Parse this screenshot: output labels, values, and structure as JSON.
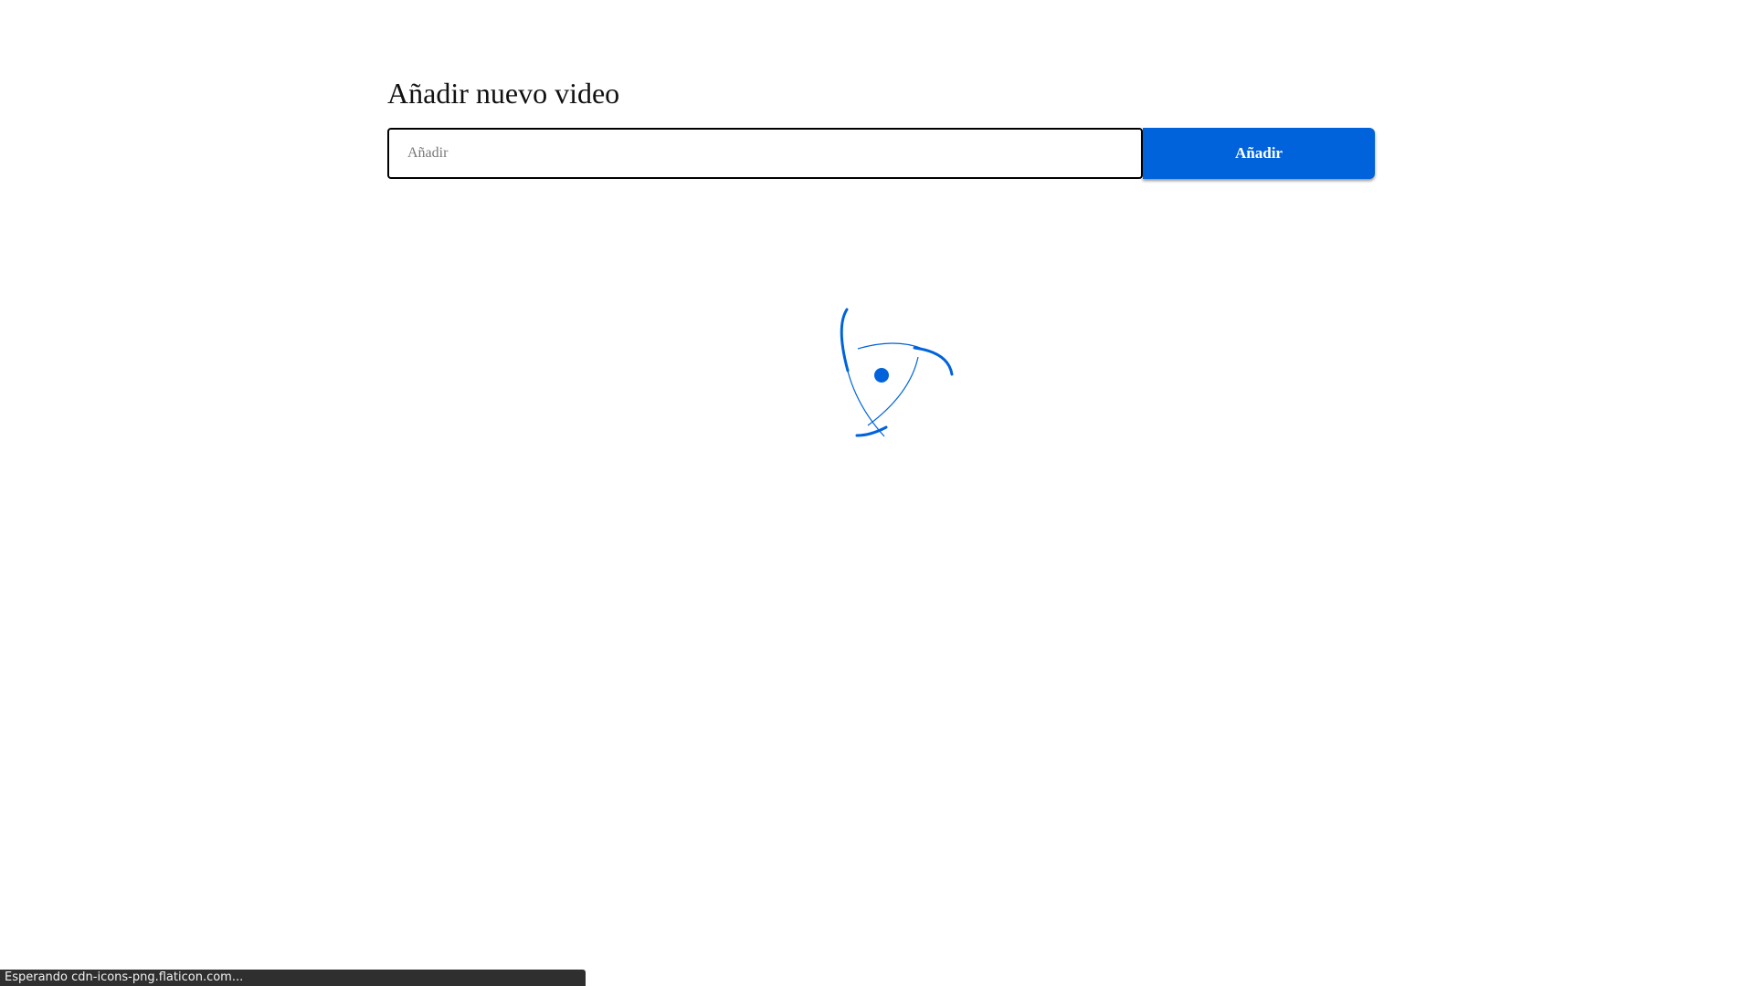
{
  "page": {
    "title": "Añadir nuevo video"
  },
  "form": {
    "input_placeholder": "Añadir",
    "input_value": "",
    "button_label": "Añadir"
  },
  "loader": {
    "icon": "spinner-icon",
    "color": "#0063dc"
  },
  "status_bar": {
    "text": "Esperando cdn-icons-png.flaticon.com..."
  },
  "colors": {
    "accent": "#0063dc",
    "status_bar_bg": "#2f2f2f"
  }
}
